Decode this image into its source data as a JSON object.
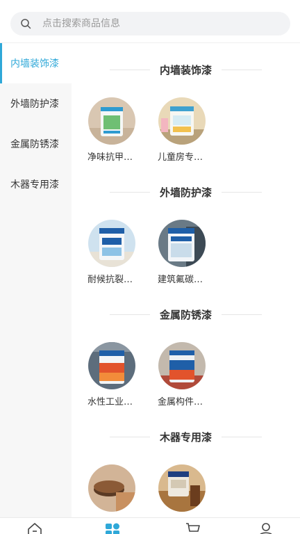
{
  "search": {
    "placeholder": "点击搜索商品信息"
  },
  "sidebar": {
    "items": [
      {
        "label": "内墙装饰漆"
      },
      {
        "label": "外墙防护漆"
      },
      {
        "label": "金属防锈漆"
      },
      {
        "label": "木器专用漆"
      }
    ]
  },
  "sections": [
    {
      "title": "内墙装饰漆",
      "products": [
        {
          "name": "净味抗甲…",
          "can_label": ""
        },
        {
          "name": "儿童房专…",
          "can_label": ""
        }
      ]
    },
    {
      "title": "外墙防护漆",
      "products": [
        {
          "name": "耐候抗裂…",
          "can_label": ""
        },
        {
          "name": "建筑氟碳…",
          "can_label": "建筑防护漆"
        }
      ]
    },
    {
      "title": "金属防锈漆",
      "products": [
        {
          "name": "水性工业…",
          "can_label": ""
        },
        {
          "name": "金属构件…",
          "can_label": ""
        }
      ]
    },
    {
      "title": "木器专用漆",
      "products": [
        {
          "name": "",
          "can_label": ""
        },
        {
          "name": "",
          "can_label": ""
        }
      ]
    }
  ],
  "tabbar": {
    "active_tab": "category"
  },
  "colors": {
    "accent": "#2fa8d8",
    "sidebar_bg": "#f7f7f7"
  }
}
